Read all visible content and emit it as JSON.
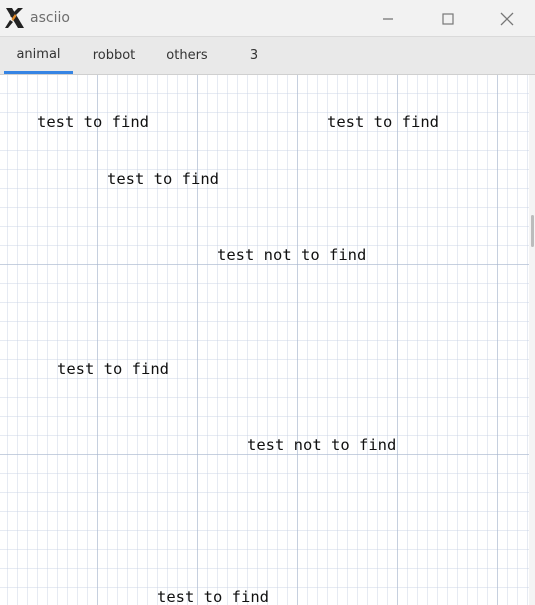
{
  "window": {
    "title": "asciio"
  },
  "tabs": [
    {
      "label": "animal",
      "active": true
    },
    {
      "label": "robbot",
      "active": false
    },
    {
      "label": "others",
      "active": false
    },
    {
      "label": "3",
      "active": false
    }
  ],
  "canvas": {
    "texts": [
      "test to find",
      "test to find",
      "test to find",
      "test not to find",
      "test to find",
      "test not to find",
      "test to find"
    ]
  },
  "colors": {
    "accent": "#3584e4",
    "grid_major": "#a0afc8",
    "grid_minor": "#c8d2e4"
  },
  "icons": {
    "logo": "x-logo-icon",
    "minimize": "minimize-icon",
    "maximize": "maximize-icon",
    "close": "close-icon"
  }
}
